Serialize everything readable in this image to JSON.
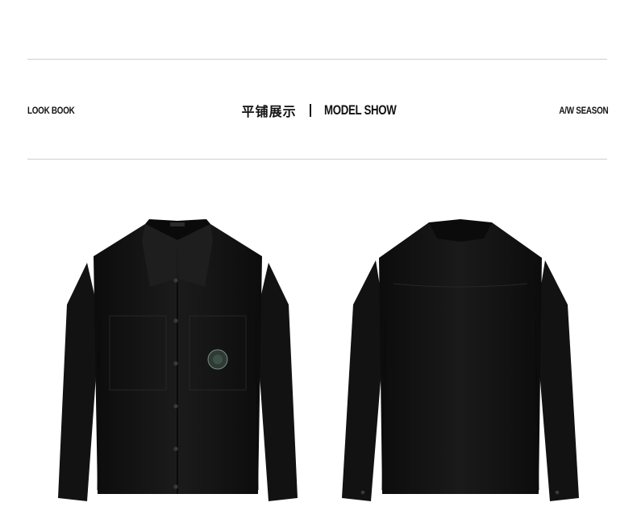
{
  "header": {
    "left_label": "LOOK BOOK",
    "title_cn": "平铺展示",
    "title_en": "MODEL SHOW",
    "right_label": "A/W SEASON"
  },
  "products": [
    {
      "view": "front",
      "icon": "jacket-front-image"
    },
    {
      "view": "back",
      "icon": "jacket-back-image"
    }
  ],
  "colors": {
    "jacket": "#151515",
    "rule": "#cfcfcf",
    "text": "#111111"
  }
}
